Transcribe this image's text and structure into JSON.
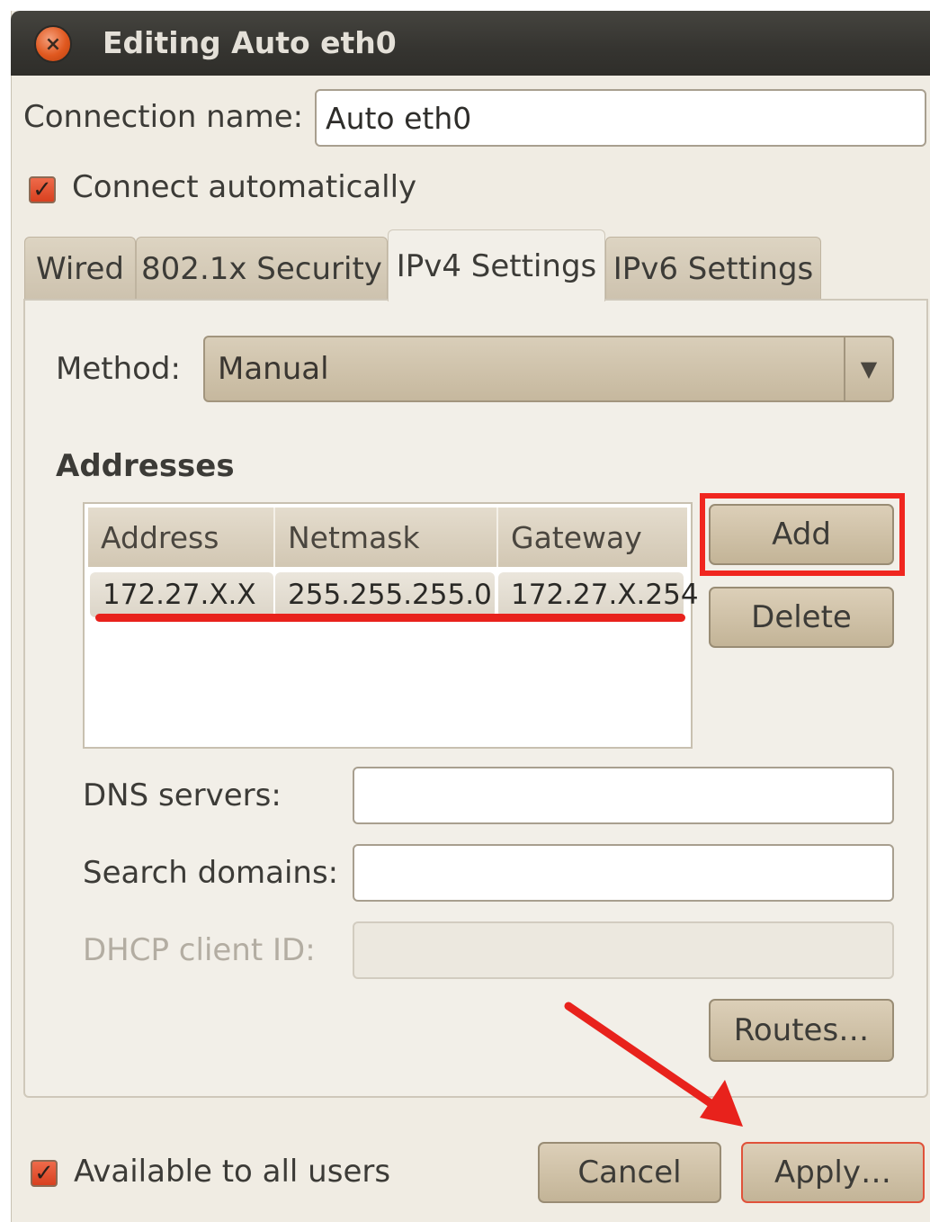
{
  "window": {
    "title": "Editing Auto eth0",
    "close_icon": "×"
  },
  "connection": {
    "name_label": "Connection name:",
    "name_value": "Auto eth0",
    "connect_auto_label": "Connect automatically",
    "connect_auto_checked": true
  },
  "tabs": [
    {
      "label": "Wired",
      "active": false
    },
    {
      "label": "802.1x Security",
      "active": false
    },
    {
      "label": "IPv4 Settings",
      "active": true
    },
    {
      "label": "IPv6 Settings",
      "active": false
    }
  ],
  "ipv4": {
    "method_label": "Method:",
    "method_value": "Manual",
    "dropdown_arrow": "▼",
    "addresses_heading": "Addresses",
    "columns": [
      "Address",
      "Netmask",
      "Gateway"
    ],
    "rows": [
      [
        "172.27.X.X",
        "255.255.255.0",
        "172.27.X.254"
      ]
    ],
    "add_label": "Add",
    "delete_label": "Delete",
    "dns_label": "DNS servers:",
    "dns_value": "",
    "search_label": "Search domains:",
    "search_value": "",
    "dhcp_label": "DHCP client ID:",
    "dhcp_value": "",
    "routes_label": "Routes…"
  },
  "footer": {
    "available_label": "Available to all users",
    "available_checked": true,
    "cancel_label": "Cancel",
    "apply_label": "Apply…"
  },
  "annotations": {
    "highlight_color": "#f0261f"
  }
}
